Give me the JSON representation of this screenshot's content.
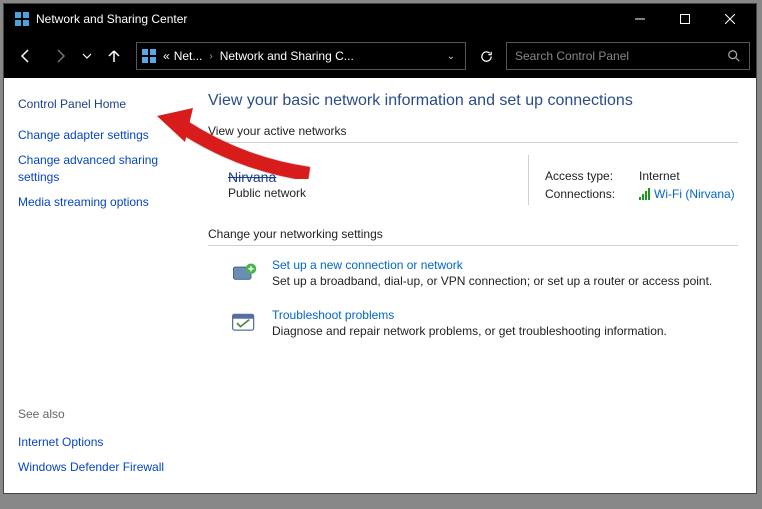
{
  "titlebar": {
    "title": "Network and Sharing Center"
  },
  "breadcrumb": {
    "level1": "Net...",
    "level2": "Network and Sharing C..."
  },
  "search": {
    "placeholder": "Search Control Panel"
  },
  "sidebar": {
    "home": "Control Panel Home",
    "links": {
      "adapter": "Change adapter settings",
      "advanced": "Change advanced sharing settings",
      "media": "Media streaming options"
    },
    "seealso_label": "See also",
    "seealso": {
      "inet": "Internet Options",
      "firewall": "Windows Defender Firewall"
    }
  },
  "content": {
    "heading": "View your basic network information and set up connections",
    "active_label": "View your active networks",
    "network": {
      "name": "Nirvana",
      "type": "Public network",
      "access_label": "Access type:",
      "access_value": "Internet",
      "conn_label": "Connections:",
      "conn_value": "Wi-Fi (Nirvana)"
    },
    "change_label": "Change your networking settings",
    "setup": {
      "title": "Set up a new connection or network",
      "desc": "Set up a broadband, dial-up, or VPN connection; or set up a router or access point."
    },
    "troubleshoot": {
      "title": "Troubleshoot problems",
      "desc": "Diagnose and repair network problems, or get troubleshooting information."
    }
  }
}
